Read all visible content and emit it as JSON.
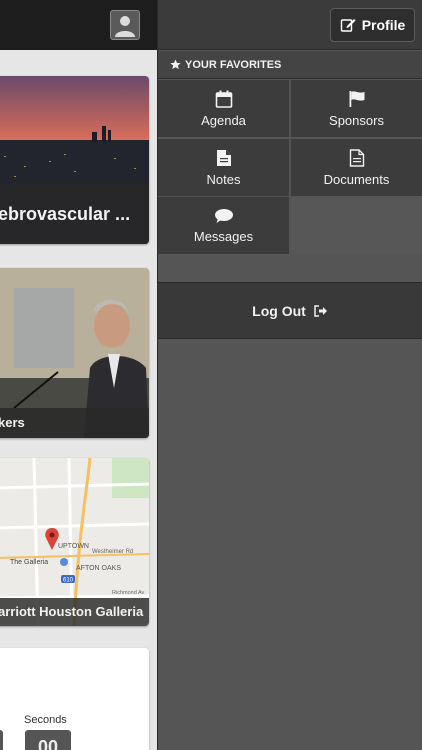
{
  "left": {
    "cards": [
      {
        "label": "ebrovascular ..."
      },
      {
        "label": "kers"
      },
      {
        "label": "arriott Houston Galleria"
      }
    ],
    "map": {
      "uptown": "UPTOWN",
      "galleria": "The Galleria",
      "afton_oaks": "AFTON OAKS",
      "westheimer": "Westheimer Rd",
      "richmond": "Richmond Av",
      "highway": "610"
    },
    "countdown": {
      "seconds_label": "Seconds",
      "seconds_value": "00"
    }
  },
  "right": {
    "profile_label": "Profile",
    "favorites_header": "YOUR FAVORITES",
    "tiles": [
      {
        "label": "Agenda",
        "icon": "calendar-icon"
      },
      {
        "label": "Sponsors",
        "icon": "flag-icon"
      },
      {
        "label": "Notes",
        "icon": "note-icon"
      },
      {
        "label": "Documents",
        "icon": "document-icon"
      },
      {
        "label": "Messages",
        "icon": "chat-bubble-icon"
      }
    ],
    "logout_label": "Log Out"
  }
}
